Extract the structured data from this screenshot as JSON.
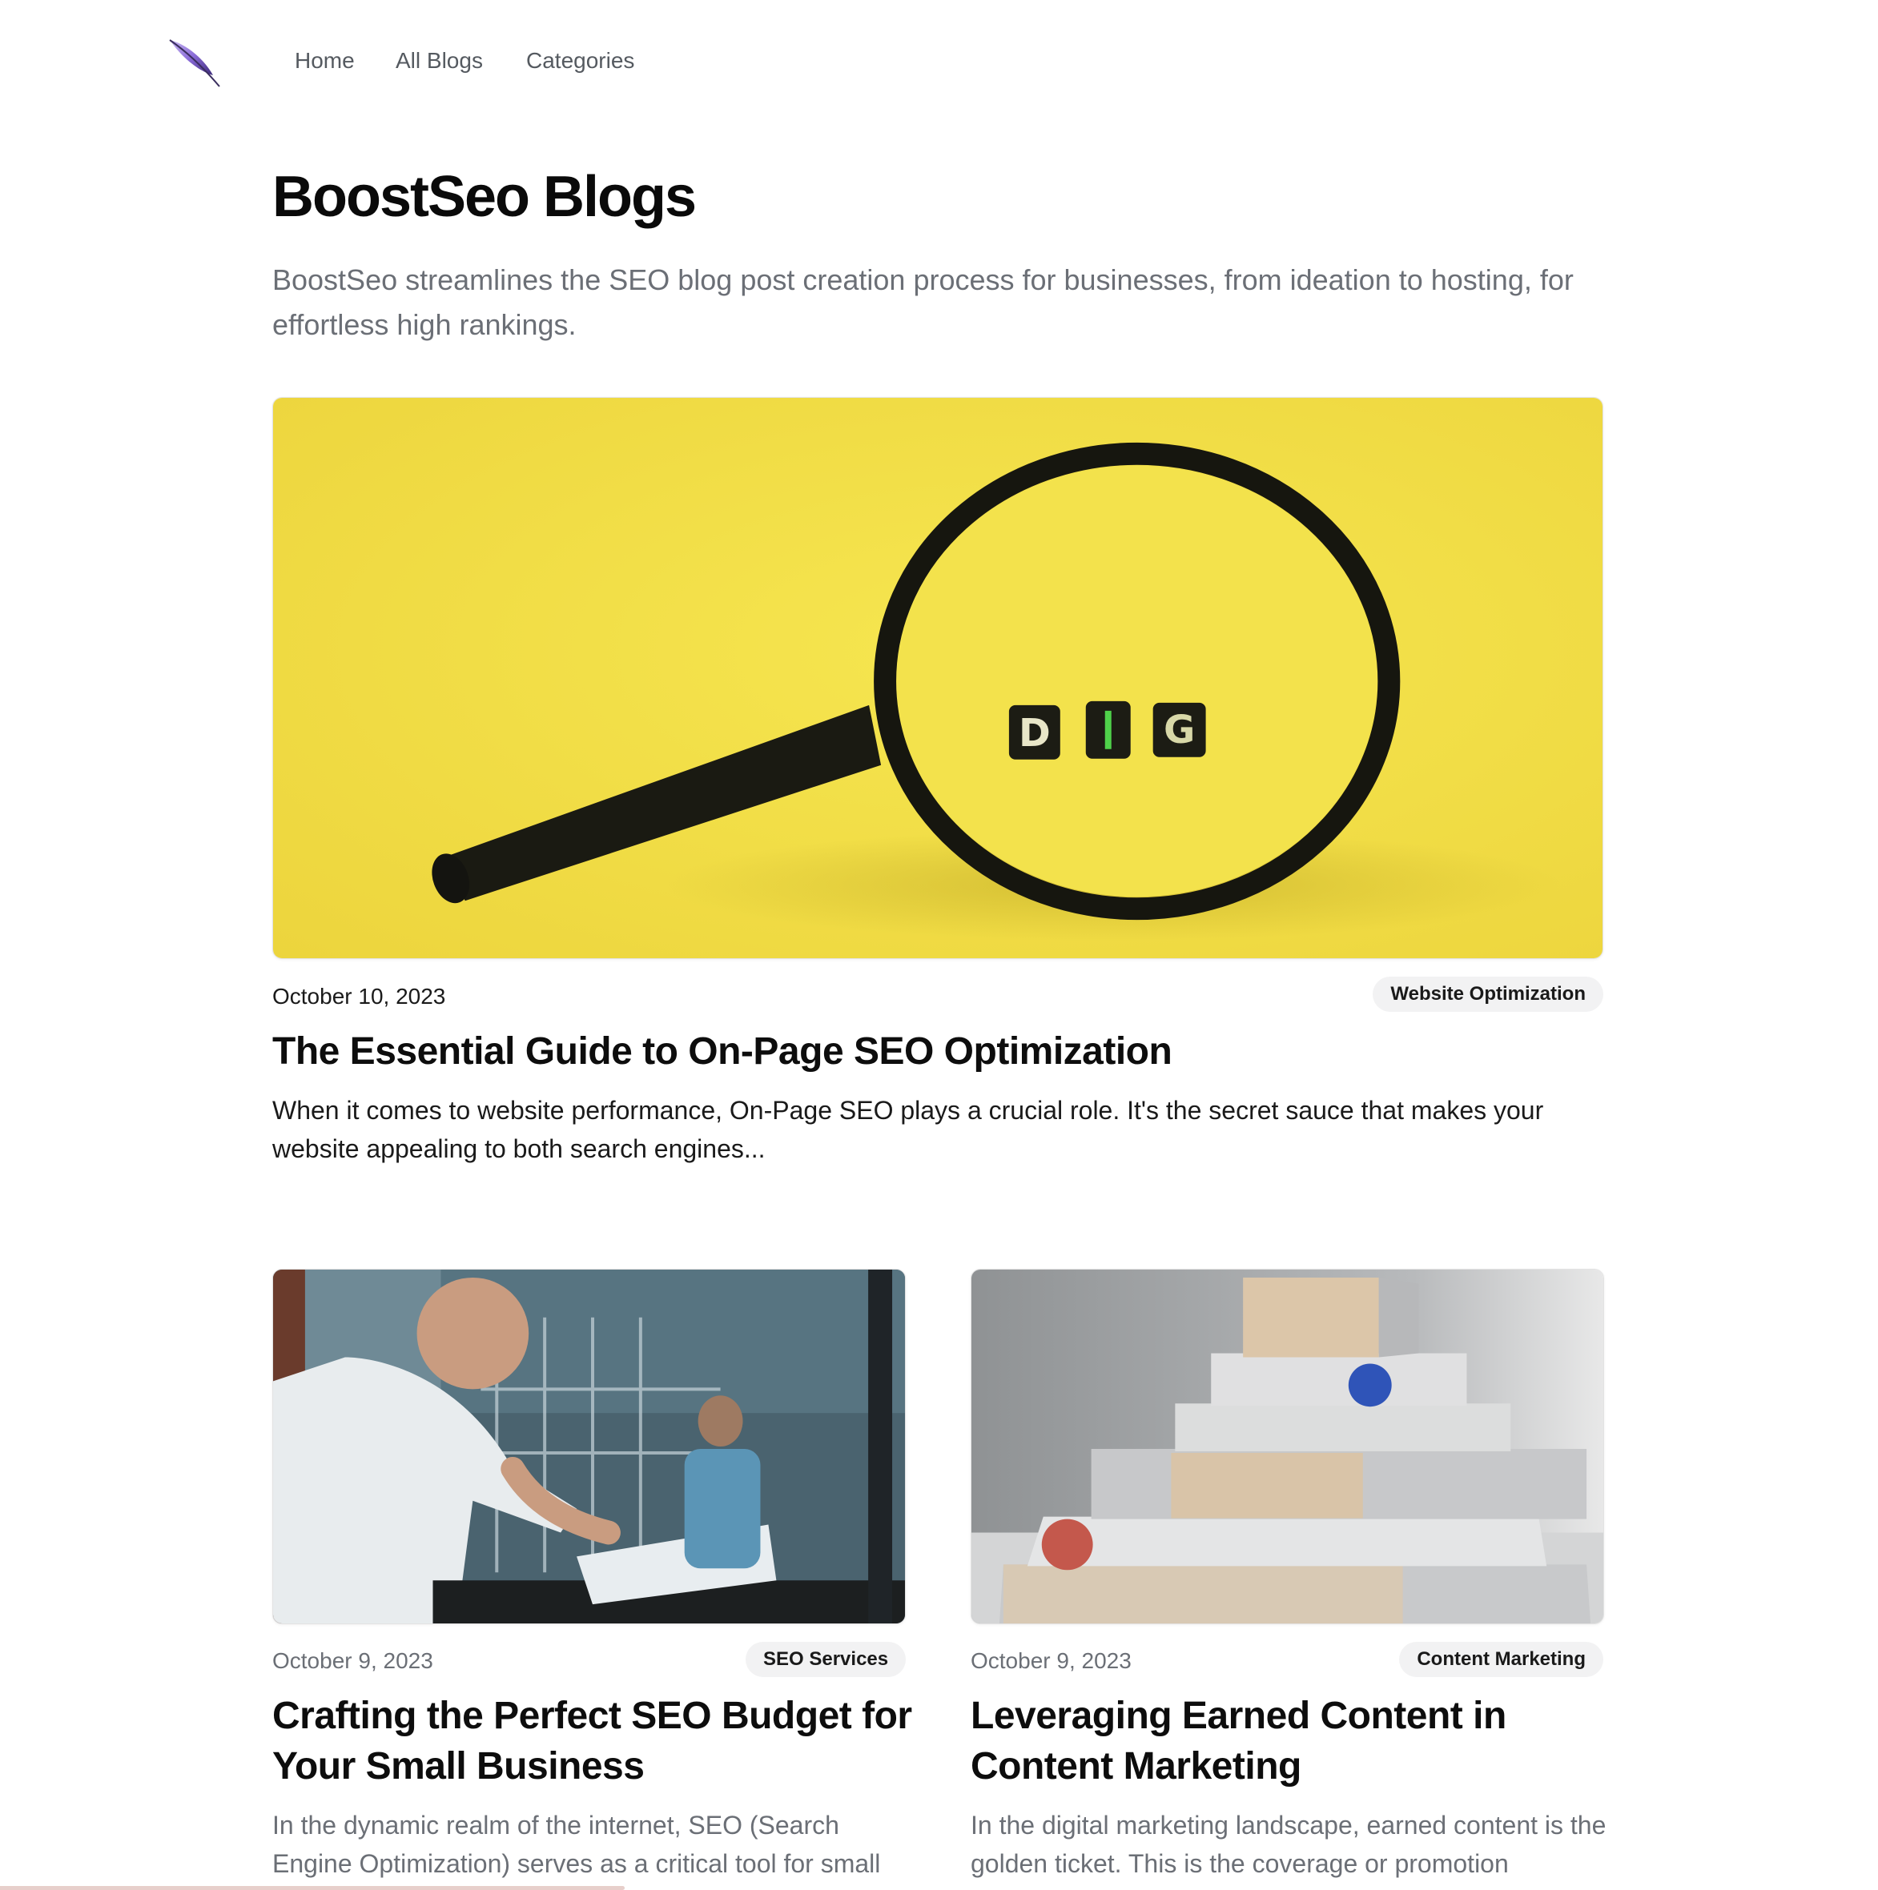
{
  "nav": {
    "logo_icon": "feather-quill-icon",
    "links": [
      "Home",
      "All Blogs",
      "Categories"
    ]
  },
  "hero": {
    "title": "BoostSeo Blogs",
    "subtitle": "BoostSeo streamlines the SEO blog post creation process for businesses, from ideation to hosting, for effortless high rankings."
  },
  "featured": {
    "image": "magnifying-glass-over-dig-letter-blocks-on-yellow",
    "date": "October 10, 2023",
    "category": "Website Optimization",
    "title": "The Essential Guide to On-Page SEO Optimization",
    "excerpt": "When it comes to website performance, On-Page SEO plays a crucial role. It's the secret sauce that makes your website appealing to both search engines..."
  },
  "posts": [
    {
      "image": "man-working-on-laptop-at-cafe-window",
      "date": "October 9, 2023",
      "category": "SEO Services",
      "title": "Crafting the Perfect SEO Budget for Your Small Business",
      "excerpt": "In the dynamic realm of the internet, SEO (Search Engine Optimization) serves as a critical tool for small"
    },
    {
      "image": "stepped-pyramid-blocks-with-spheres",
      "date": "October 9, 2023",
      "category": "Content Marketing",
      "title": "Leveraging Earned Content in Content Marketing",
      "excerpt": "In the digital marketing landscape, earned content is the golden ticket. This is the coverage or promotion"
    }
  ],
  "colors": {
    "accent": "#8a6bd8",
    "badge_bg": "#f2f2f3",
    "muted_text": "#6b6f76",
    "featured_image_bg": "#f2e24e"
  }
}
